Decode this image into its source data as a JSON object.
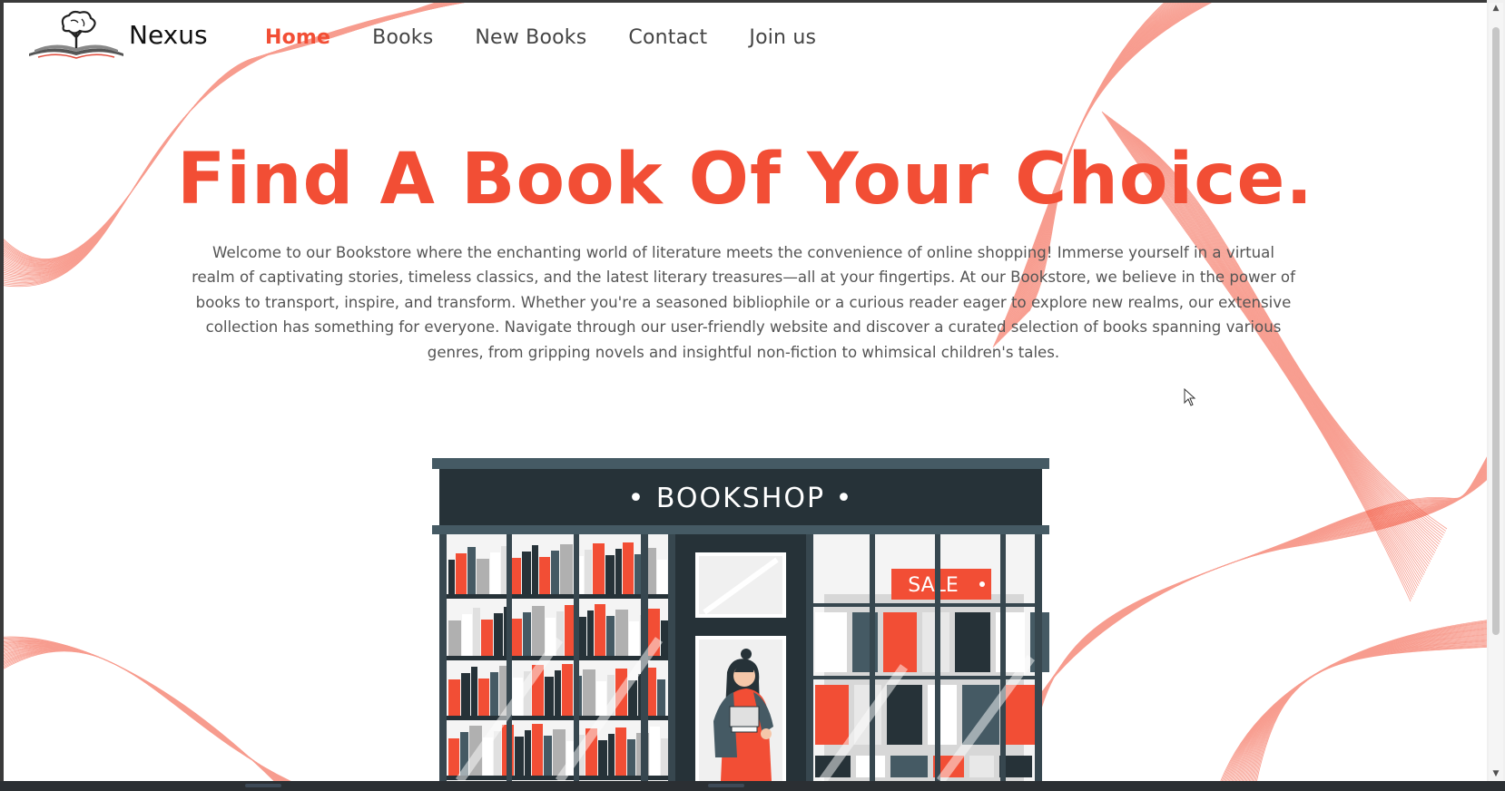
{
  "brand": {
    "name": "Nexus",
    "icon": "book-tree-icon"
  },
  "nav": {
    "items": [
      {
        "label": "Home",
        "active": true
      },
      {
        "label": "Books",
        "active": false
      },
      {
        "label": "New Books",
        "active": false
      },
      {
        "label": "Contact",
        "active": false
      },
      {
        "label": "Join us",
        "active": false
      }
    ]
  },
  "hero": {
    "title": "Find A Book Of Your Choice.",
    "description": "Welcome to our Bookstore where the enchanting world of literature meets the convenience of online shopping! Immerse yourself in a virtual realm of captivating stories, timeless classics, and the latest literary treasures—all at your fingertips. At our Bookstore, we believe in the power of books to transport, inspire, and transform. Whether you're a seasoned bibliophile or a curious reader eager to explore new realms, our extensive collection has something for everyone. Navigate through our user-friendly website and discover a curated selection of books spanning various genres, from gripping novels and insightful non-fiction to whimsical children's tales."
  },
  "illustration": {
    "sign_text": "• BOOKSHOP •",
    "sale_text": "SALE"
  },
  "colors": {
    "accent": "#f24e35",
    "dark": "#263238",
    "text": "#555555"
  }
}
